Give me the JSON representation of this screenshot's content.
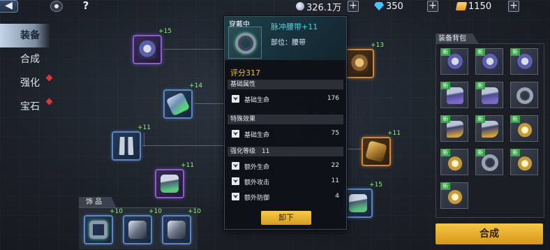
{
  "topbar": {
    "back_icon": "back-arrow-icon",
    "home_icon": "home-icon",
    "help_label": "?",
    "resources": [
      {
        "icon": "crystal-icon",
        "value": "326.1万"
      },
      {
        "icon": "diamond-icon",
        "value": "350"
      },
      {
        "icon": "ticket-icon",
        "value": "1150"
      }
    ],
    "plus_label": "+"
  },
  "nav": {
    "items": [
      {
        "label": "装备",
        "active": true,
        "alert": false
      },
      {
        "label": "合成",
        "active": false,
        "alert": false
      },
      {
        "label": "强化",
        "active": false,
        "alert": true
      },
      {
        "label": "宝石",
        "active": false,
        "alert": true
      }
    ]
  },
  "equip_slots": [
    {
      "name": "helmet",
      "level": "+15",
      "rarity": "purple"
    },
    {
      "name": "glove",
      "level": "+14",
      "rarity": "blue"
    },
    {
      "name": "pants",
      "level": "+11",
      "rarity": "blue"
    },
    {
      "name": "boots",
      "level": "+11",
      "rarity": "purple"
    },
    {
      "name": "armor",
      "level": "+13",
      "rarity": "orange"
    },
    {
      "name": "gauntlet",
      "level": "+11",
      "rarity": "orange"
    },
    {
      "name": "shoes",
      "level": "+15",
      "rarity": "blue"
    }
  ],
  "accessories": {
    "title": "饰 品",
    "items": [
      {
        "name": "ring",
        "level": "+10"
      },
      {
        "name": "bracer",
        "level": "+10"
      },
      {
        "name": "brooch",
        "level": "+10"
      }
    ]
  },
  "tooltip": {
    "tag": "穿戴中",
    "item_name": "脉冲腰带+11",
    "part_label": "部位：腰带",
    "score": "评分317",
    "base_title": "基础属性",
    "base_rows": [
      {
        "label": "基础生命",
        "value": "176"
      }
    ],
    "special_title": "特殊效果",
    "special_rows": [
      {
        "label": "基础生命",
        "value": "75"
      }
    ],
    "enhance_title": "强化等级",
    "enhance_level": "11",
    "enhance_rows": [
      {
        "label": "额外生命",
        "value": "22"
      },
      {
        "label": "额外攻击",
        "value": "11"
      },
      {
        "label": "额外防御",
        "value": "4"
      }
    ],
    "unequip_label": "卸下"
  },
  "bag": {
    "title": "装备背包",
    "new_label": "新",
    "compose_label": "合成"
  }
}
